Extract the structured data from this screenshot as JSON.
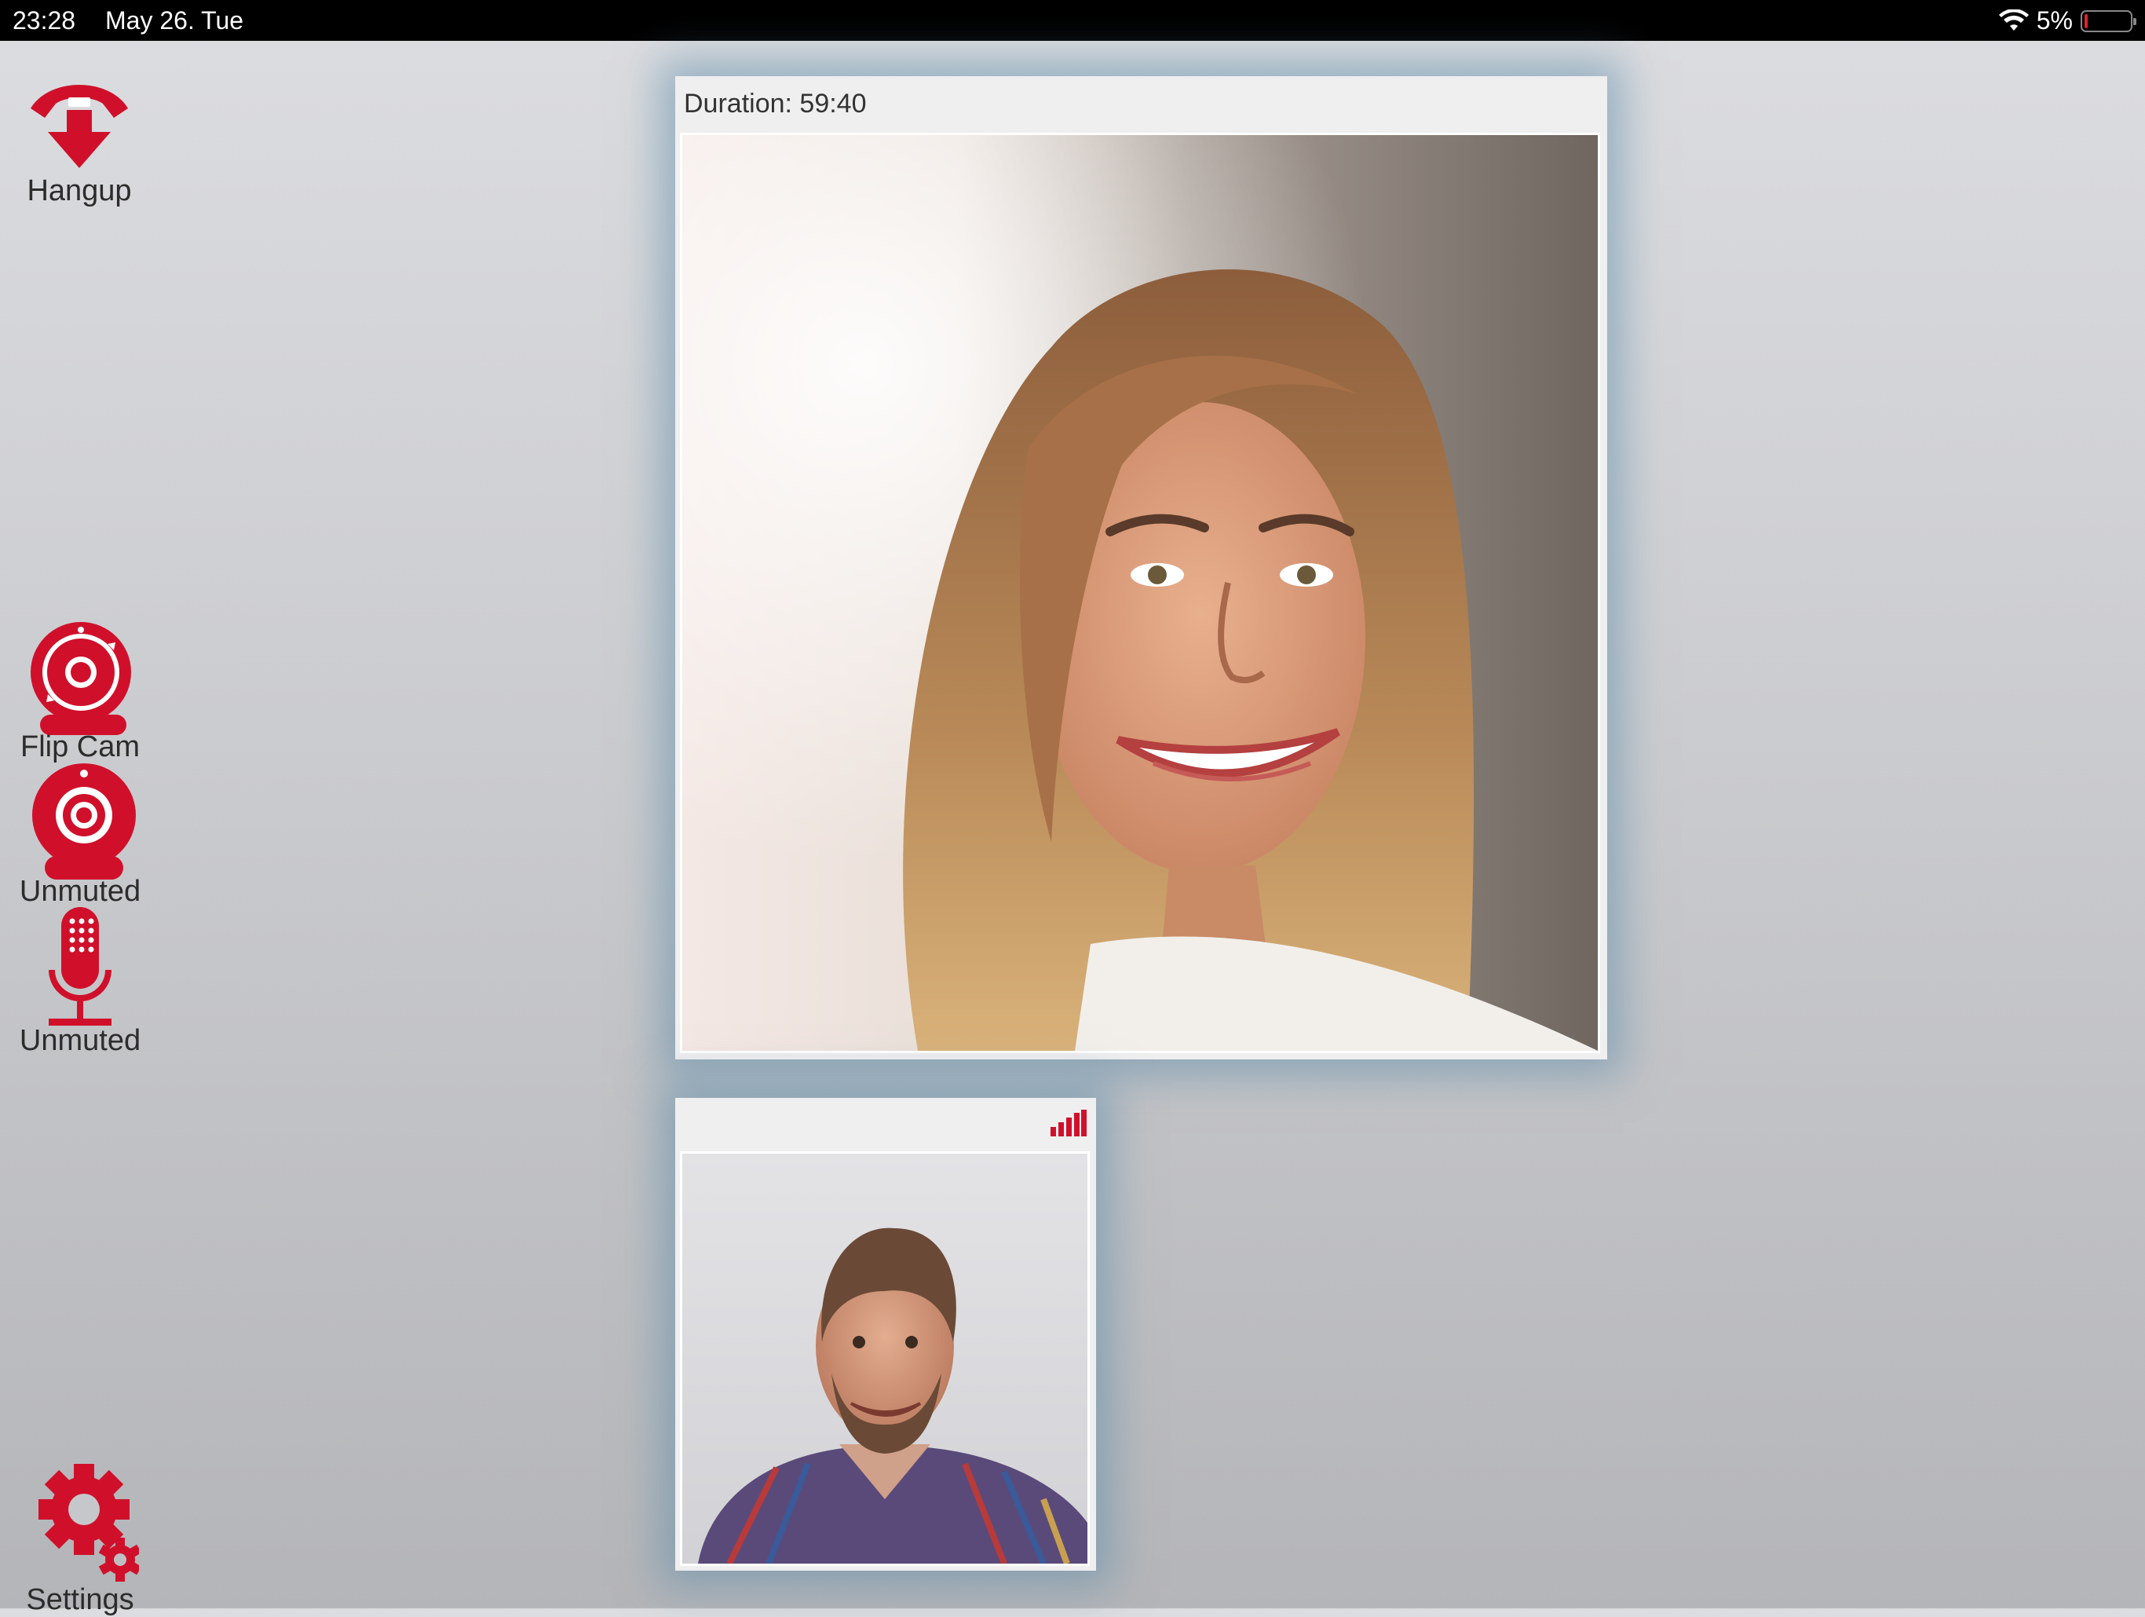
{
  "status_bar": {
    "time": "23:28",
    "date": "May 26. Tue",
    "battery_percent": "5%",
    "battery_level": 0.05,
    "wifi_icon": "wifi-icon"
  },
  "sidebar": {
    "hangup_label": "Hangup",
    "flip_cam_label": "Flip Cam",
    "video_label": "Unmuted",
    "mic_label": "Unmuted",
    "settings_label": "Settings"
  },
  "call": {
    "duration": "Duration: 59:40",
    "signal_icon": "signal-bars-icon"
  },
  "colors": {
    "accent": "#d0102b",
    "background": "#c9cacd",
    "panel_glow": "#5f8caa"
  }
}
